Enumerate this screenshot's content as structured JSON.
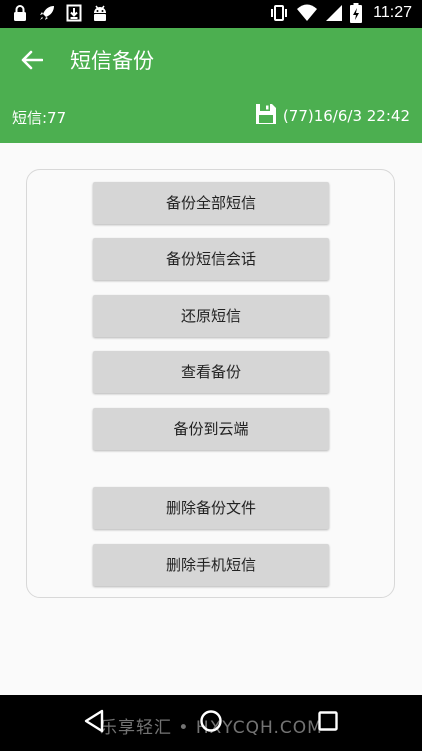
{
  "status_bar": {
    "time": "11:27",
    "icons_left": [
      "lock-icon",
      "rocket-icon",
      "download-icon",
      "android-icon"
    ],
    "icons_right": [
      "vibrate-icon",
      "wifi-icon",
      "signal-icon",
      "battery-charging-icon"
    ]
  },
  "app_bar": {
    "title": "短信备份",
    "sms_count": "短信:77",
    "backup_info": "(77)16/6/3 22:42",
    "color": "#4caf50"
  },
  "buttons": {
    "backup_all": "备份全部短信",
    "backup_conversation": "备份短信会话",
    "restore": "还原短信",
    "view_backup": "查看备份",
    "backup_cloud": "备份到云端",
    "delete_backup_file": "删除备份文件",
    "delete_phone_sms": "删除手机短信"
  },
  "watermark": "乐享轻汇 • HXYCQH.COM"
}
